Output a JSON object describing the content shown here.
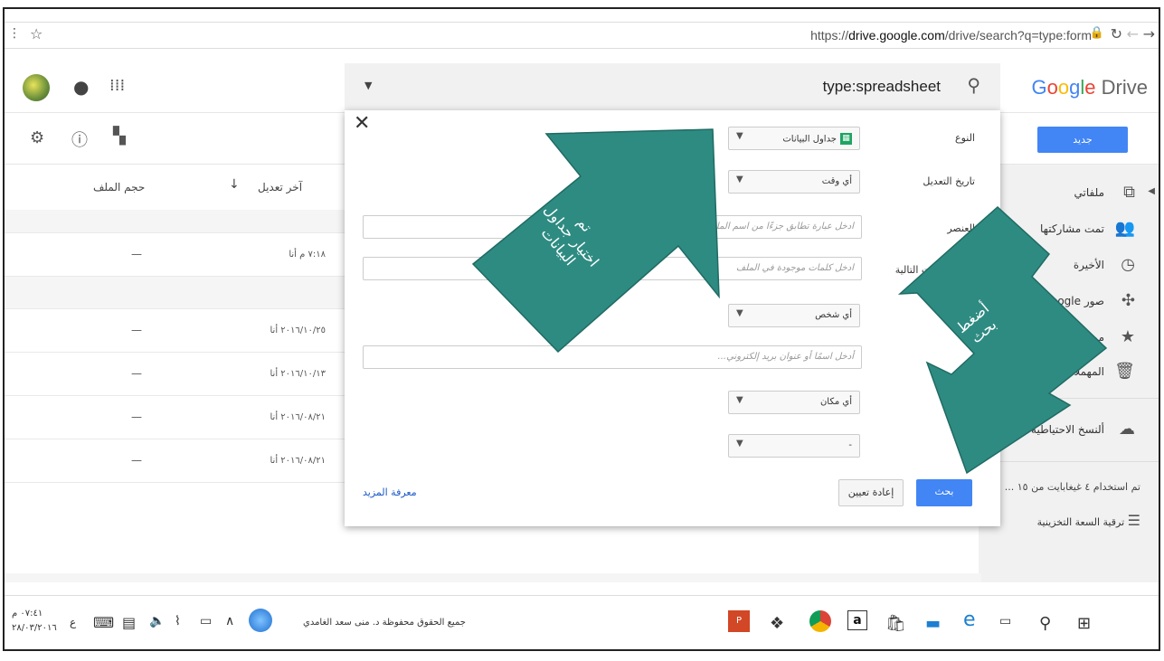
{
  "browser": {
    "url_prefix": "https://",
    "url_host": "drive.google.com",
    "url_rest": "/drive/search?q=type:form"
  },
  "header": {
    "search_query": "type:spreadsheet",
    "logo": "Google Drive"
  },
  "toolbar": {
    "new_label": "جديد"
  },
  "sidebar": {
    "items": [
      {
        "label": "ملفاتي",
        "icon": "drive-icon"
      },
      {
        "label": "تمت مشاركتها",
        "icon": "people-icon"
      },
      {
        "label": "الأخيرة",
        "icon": "clock-icon"
      },
      {
        "label": "صور Google",
        "icon": "photos-icon"
      },
      {
        "label": "مميز",
        "icon": "star-icon"
      },
      {
        "label": "المهملات",
        "icon": "trash-icon"
      },
      {
        "label": "ألنسخ الاحتياطية",
        "icon": "cloud-icon"
      }
    ],
    "storage_text": "تم استخدام ٤ غيغابايت من ١٥ ...",
    "upgrade_label": "ترقية السعة التخزينية"
  },
  "list": {
    "col_modified": "آخر تعديل",
    "col_size": "حجم الملف",
    "rows": [
      {
        "modified": "٧:١٨ م أنا",
        "size": "—"
      },
      {
        "modified": "٢٠١٦/١٠/٢٥ أنا",
        "size": "—"
      },
      {
        "modified": "٢٠١٦/١٠/١٣ أنا",
        "size": "—"
      },
      {
        "modified": "٢٠١٦/٠٨/٢١ أنا",
        "size": "—"
      },
      {
        "modified": "٢٠١٦/٠٨/٢١ أنا",
        "size": "—"
      }
    ]
  },
  "dialog": {
    "type_label": "النوع",
    "type_value": "جداول البيانات",
    "modified_label": "تاريخ التعديل",
    "modified_value": "أي وقت",
    "item_label": "العنصر",
    "item_placeholder": "ادخل عبارة تطابق جزءًا من اسم الملف",
    "words_label": "على الكلمات التالية",
    "words_placeholder": "ادخل كلمات موجودة في الملف",
    "owner_value": "أي شخص",
    "shared_placeholder": "أدخل اسمًا أو عنوان بريد إلكتروني...",
    "location_value": "أي مكان",
    "extra_value": "-",
    "search_button": "بحث",
    "reset_button": "إعادة تعيين",
    "learn_more": "معرفة المزيد"
  },
  "annotations": {
    "arrow1_text": [
      "تم",
      "اختيار جداول",
      "البيانات"
    ],
    "arrow2_text": [
      "أضغط",
      "بحث"
    ],
    "arrow_color": "#2e8b82"
  },
  "taskbar": {
    "time": "٠٧:٤١ م",
    "date": "٢٨/٠٣/٢٠١٦",
    "lang": "ع",
    "copyright": "جميع الحقوق محفوظة د. منى سعد الغامدي"
  }
}
